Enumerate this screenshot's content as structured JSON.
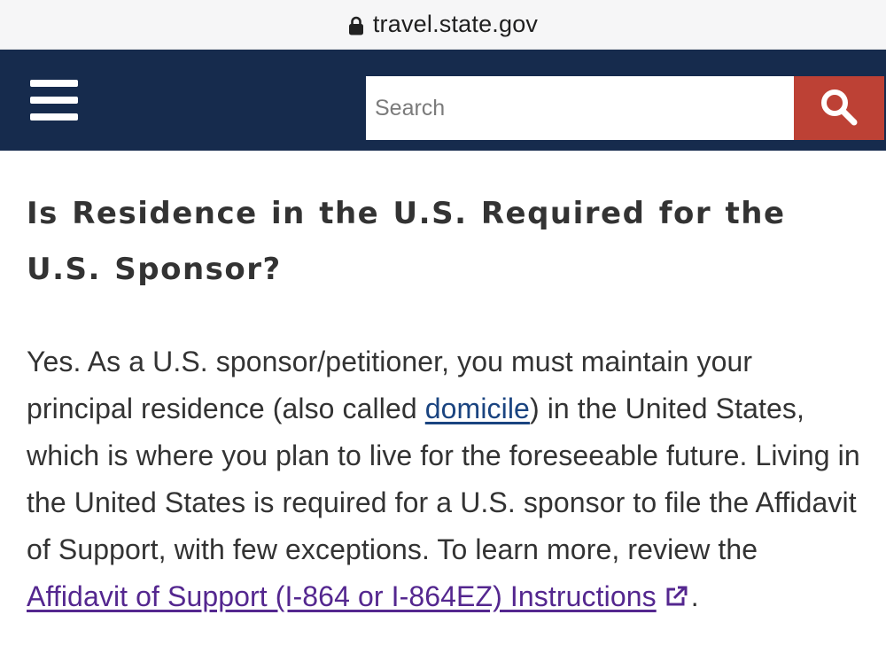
{
  "browser": {
    "url": "travel.state.gov"
  },
  "header": {
    "search_placeholder": "Search"
  },
  "main": {
    "title": "Is Residence in the U.S. Required for the U.S. Sponsor?",
    "paragraph": {
      "text_1": "Yes. As a U.S. sponsor/petitioner, you must maintain your principal residence (also called ",
      "link_domicile": "domicile",
      "text_2": ") in the United States, which is where you plan to live for the foreseeable future. Living in the United States is required for a U.S. sponsor to file the Affidavit of Support, with few exceptions. To learn more, review the ",
      "link_affidavit": "Affidavit of Support (I-864 or I-864EZ) Instructions",
      "text_3": "."
    }
  },
  "colors": {
    "header_bg": "#162b4d",
    "search_button_bg": "#bd4135",
    "link_blue": "#1a4480",
    "link_visited_purple": "#54278f",
    "body_text": "#333333"
  },
  "icons": {
    "lock": "lock-icon",
    "menu": "hamburger-menu-icon",
    "search": "search-icon",
    "external_link": "external-link-icon"
  }
}
